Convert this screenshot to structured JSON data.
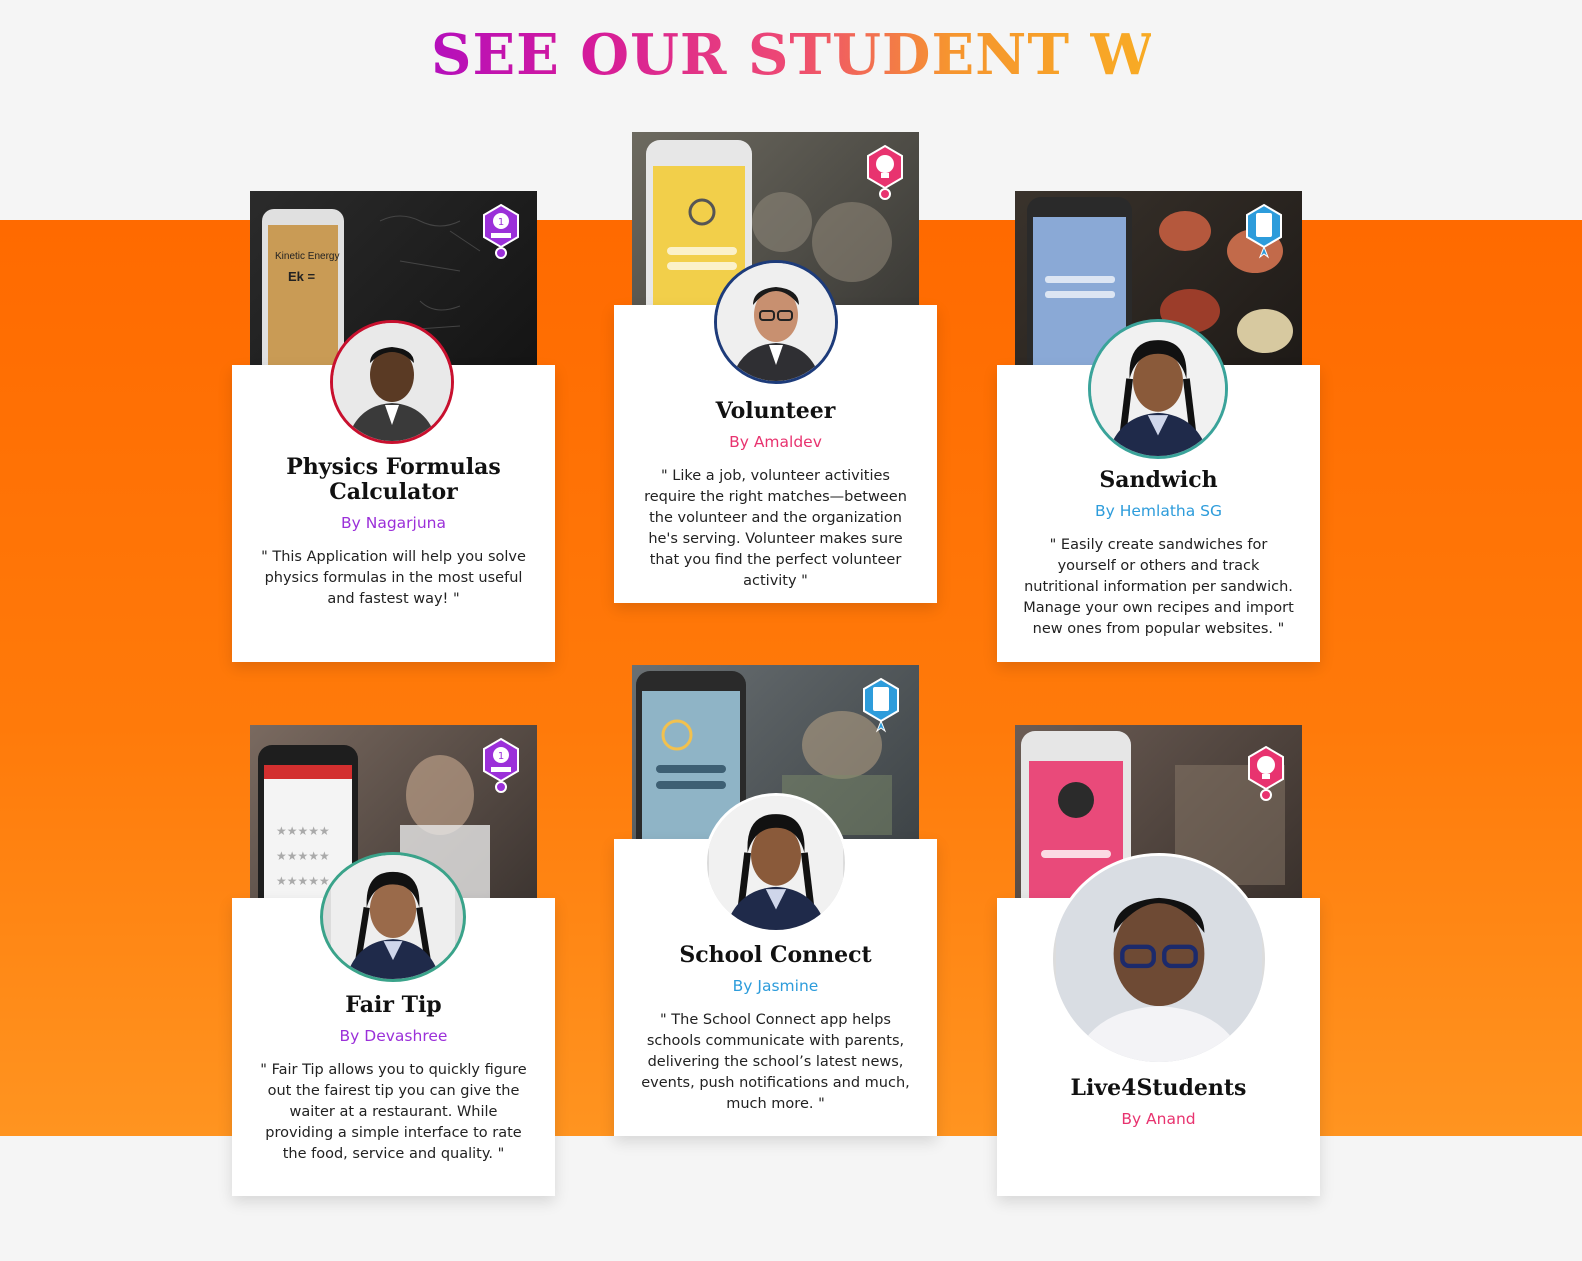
{
  "heading": "SEE OUR STUDENT WORK",
  "colors": {
    "band_top": "#ff6a00",
    "band_bottom": "#ff9420",
    "purple": "#9b30d9",
    "pink": "#e8336f",
    "blue": "#2d9cdb"
  },
  "projects": [
    {
      "title": "Physics Formulas Calculator",
      "author": "By Nagarjuna",
      "author_color": "#9b30d9",
      "description": "\" This Application will help you solve physics formulas in the most useful and fastest way! \"",
      "badge": "trophy-badge-icon",
      "screen_text_1": "Kinetic Energy",
      "screen_text_2": "Ek ="
    },
    {
      "title": "Volunteer",
      "author": "By Amaldev",
      "author_color": "#e8336f",
      "description": "\" Like a job, volunteer activities require the right matches—between the volunteer and the organization he's serving. Volunteer makes sure that you find the perfect volunteer activity \"",
      "badge": "lightbulb-badge-icon"
    },
    {
      "title": "Sandwich",
      "author": "By Hemlatha SG",
      "author_color": "#2d9cdb",
      "description": "\" Easily create sandwiches for yourself or others and track nutritional information per sandwich. Manage your own recipes and import new ones from popular websites. \"",
      "badge": "mobile-code-badge-icon"
    },
    {
      "title": "Fair Tip",
      "author": "By Devashree",
      "author_color": "#9b30d9",
      "description": "\" Fair Tip allows you to quickly figure out the fairest tip you can give the waiter at a restaurant. While providing a simple interface to rate the food, service and quality. \"",
      "badge": "trophy-badge-icon"
    },
    {
      "title": "School Connect",
      "author": "By Jasmine",
      "author_color": "#2d9cdb",
      "description": "\" The School Connect app helps schools communicate with parents, delivering the school’s latest news, events, push notifications and much, much more. \"",
      "badge": "mobile-code-badge-icon"
    },
    {
      "title": "Live4Students",
      "author": "By Anand",
      "author_color": "#e8336f",
      "description": "",
      "badge": "lightbulb-badge-icon"
    }
  ]
}
